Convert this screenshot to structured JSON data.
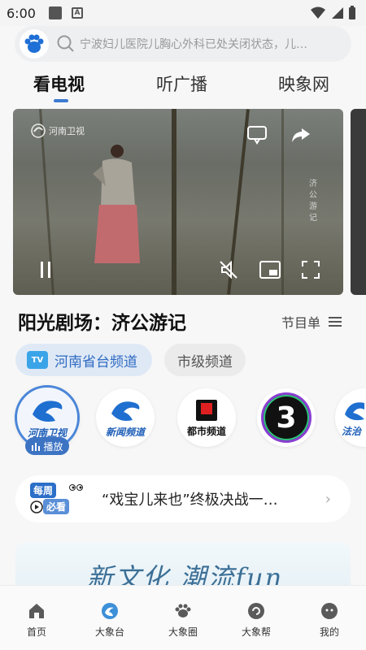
{
  "status_bar": {
    "time": "6:00"
  },
  "search": {
    "placeholder": "宁波妇儿医院儿胸心外科已处关闭状态，儿…"
  },
  "tabs": [
    {
      "label": "看电视"
    },
    {
      "label": "听广播"
    },
    {
      "label": "映象网"
    }
  ],
  "video": {
    "channel_watermark": "河南卫视",
    "caption": "济公游记"
  },
  "program": {
    "title": "阳光剧场：济公游记",
    "schedule_label": "节目单"
  },
  "categories": [
    {
      "label": "河南省台频道",
      "icon_text": "TV"
    },
    {
      "label": "市级频道"
    }
  ],
  "channels": [
    {
      "name": "河南卫视"
    },
    {
      "name": "新闻频道"
    },
    {
      "name": "都市频道"
    },
    {
      "name": "3"
    },
    {
      "name": "法治"
    }
  ],
  "playing_badge": "播放",
  "weekly": {
    "badge_top": "每周",
    "badge_bottom": "必看",
    "text": "“戏宝儿来也”终极决战一…"
  },
  "banner": {
    "text": "新文化 潮流fun"
  },
  "nav": [
    {
      "label": "首页"
    },
    {
      "label": "大象台"
    },
    {
      "label": "大象圈"
    },
    {
      "label": "大象帮"
    },
    {
      "label": "我的"
    }
  ],
  "colors": {
    "accent": "#3d7bd1",
    "pill_active_bg": "#dfe9f6",
    "pill_active_text": "#2f6bc2"
  }
}
